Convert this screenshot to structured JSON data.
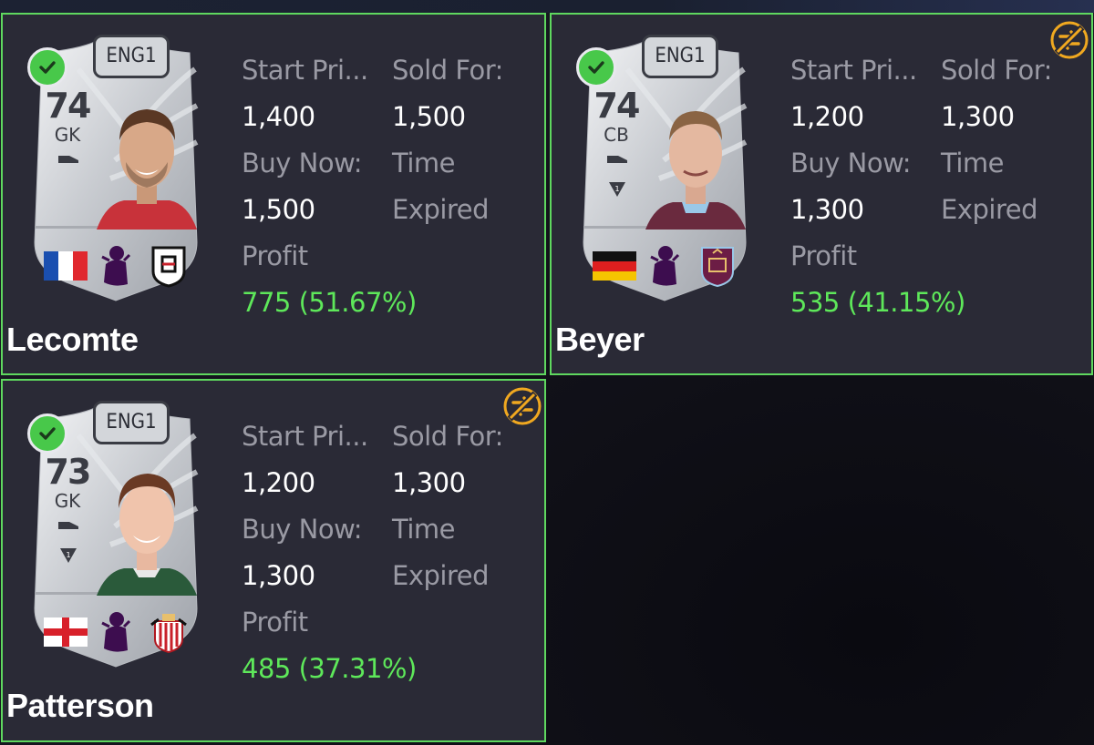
{
  "tiles": [
    {
      "name": "Lecomte",
      "rating": "74",
      "position": "GK",
      "league": "ENG1",
      "nation_flag": "france-flag",
      "club_badge": "fulham-badge",
      "chem_icon": false,
      "untradeable_icon": false,
      "start_label": "Start Pri...",
      "sold_label": "Sold For:",
      "start_price": "1,400",
      "sold_for": "1,500",
      "buy_now_label": "Buy Now:",
      "time_label": "Time",
      "buy_now": "1,500",
      "time_value": "Expired",
      "profit_label": "Profit",
      "profit": "775 (51.67%)"
    },
    {
      "name": "Beyer",
      "rating": "74",
      "position": "CB",
      "league": "ENG1",
      "nation_flag": "germany-flag",
      "club_badge": "burnley-badge",
      "chem_icon": true,
      "untradeable_icon": true,
      "start_label": "Start Pri...",
      "sold_label": "Sold For:",
      "start_price": "1,200",
      "sold_for": "1,300",
      "buy_now_label": "Buy Now:",
      "time_label": "Time",
      "buy_now": "1,300",
      "time_value": "Expired",
      "profit_label": "Profit",
      "profit": "535 (41.15%)"
    },
    {
      "name": "Patterson",
      "rating": "73",
      "position": "GK",
      "league": "ENG1",
      "nation_flag": "england-flag",
      "club_badge": "sunderland-badge",
      "chem_icon": true,
      "untradeable_icon": true,
      "start_label": "Start Pri...",
      "sold_label": "Sold For:",
      "start_price": "1,200",
      "sold_for": "1,300",
      "buy_now_label": "Buy Now:",
      "time_label": "Time",
      "buy_now": "1,300",
      "time_value": "Expired",
      "profit_label": "Profit",
      "profit": "485 (37.31%)"
    }
  ],
  "colors": {
    "tile_bg": "#2a2a36",
    "tile_border": "#5fd85f",
    "profit": "#5ee85a",
    "label": "#9a9aa4",
    "value": "#ffffff",
    "check": "#48c84a",
    "untradeable": "#f0a820"
  }
}
